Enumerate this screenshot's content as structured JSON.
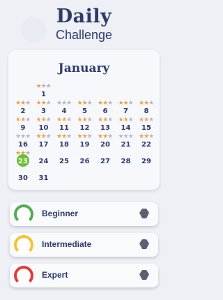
{
  "header": {
    "title": "Daily",
    "subtitle": "Challenge"
  },
  "calendar": {
    "month": "January",
    "days": [
      {
        "n": "1",
        "c": 1,
        "r": 0,
        "stars": [
          1,
          0,
          0
        ]
      },
      {
        "n": "2",
        "c": 0,
        "r": 1,
        "stars": [
          1,
          1,
          0
        ]
      },
      {
        "n": "3",
        "c": 1,
        "r": 1,
        "stars": [
          1,
          1,
          0
        ]
      },
      {
        "n": "4",
        "c": 2,
        "r": 1,
        "stars": [
          0,
          0,
          0
        ]
      },
      {
        "n": "5",
        "c": 3,
        "r": 1,
        "stars": [
          1,
          1,
          0
        ]
      },
      {
        "n": "6",
        "c": 4,
        "r": 1,
        "stars": [
          1,
          1,
          0
        ]
      },
      {
        "n": "7",
        "c": 5,
        "r": 1,
        "stars": [
          1,
          1,
          0
        ]
      },
      {
        "n": "8",
        "c": 6,
        "r": 1,
        "stars": [
          1,
          1,
          0
        ]
      },
      {
        "n": "9",
        "c": 0,
        "r": 2,
        "stars": [
          1,
          1,
          0
        ]
      },
      {
        "n": "10",
        "c": 1,
        "r": 2,
        "stars": [
          1,
          1,
          0
        ]
      },
      {
        "n": "11",
        "c": 2,
        "r": 2,
        "stars": [
          1,
          1,
          0
        ]
      },
      {
        "n": "12",
        "c": 3,
        "r": 2,
        "stars": [
          1,
          1,
          0
        ]
      },
      {
        "n": "13",
        "c": 4,
        "r": 2,
        "stars": [
          1,
          1,
          0
        ]
      },
      {
        "n": "14",
        "c": 5,
        "r": 2,
        "stars": [
          1,
          1,
          0
        ]
      },
      {
        "n": "15",
        "c": 6,
        "r": 2,
        "stars": [
          1,
          1,
          0
        ]
      },
      {
        "n": "16",
        "c": 0,
        "r": 3,
        "stars": [
          0,
          0,
          0
        ]
      },
      {
        "n": "17",
        "c": 1,
        "r": 3,
        "stars": [
          1,
          1,
          0
        ]
      },
      {
        "n": "18",
        "c": 2,
        "r": 3,
        "stars": [
          1,
          1,
          0
        ]
      },
      {
        "n": "19",
        "c": 3,
        "r": 3,
        "stars": [
          1,
          1,
          0
        ]
      },
      {
        "n": "20",
        "c": 4,
        "r": 3,
        "stars": [
          1,
          1,
          0
        ]
      },
      {
        "n": "21",
        "c": 5,
        "r": 3,
        "stars": [
          0,
          0,
          0
        ]
      },
      {
        "n": "22",
        "c": 6,
        "r": 3,
        "stars": [
          1,
          1,
          0
        ]
      },
      {
        "n": "23",
        "c": 0,
        "r": 4,
        "stars": [
          1,
          1,
          0
        ],
        "today": true
      },
      {
        "n": "24",
        "c": 1,
        "r": 4
      },
      {
        "n": "25",
        "c": 2,
        "r": 4
      },
      {
        "n": "26",
        "c": 3,
        "r": 4
      },
      {
        "n": "27",
        "c": 4,
        "r": 4
      },
      {
        "n": "28",
        "c": 5,
        "r": 4
      },
      {
        "n": "29",
        "c": 6,
        "r": 4
      },
      {
        "n": "30",
        "c": 0,
        "r": 5
      },
      {
        "n": "31",
        "c": 1,
        "r": 5
      }
    ]
  },
  "levels": [
    {
      "label": "Beginner",
      "color": "#4caf50"
    },
    {
      "label": "Intermediate",
      "color": "#f4c430"
    },
    {
      "label": "Expert",
      "color": "#e53935"
    }
  ]
}
